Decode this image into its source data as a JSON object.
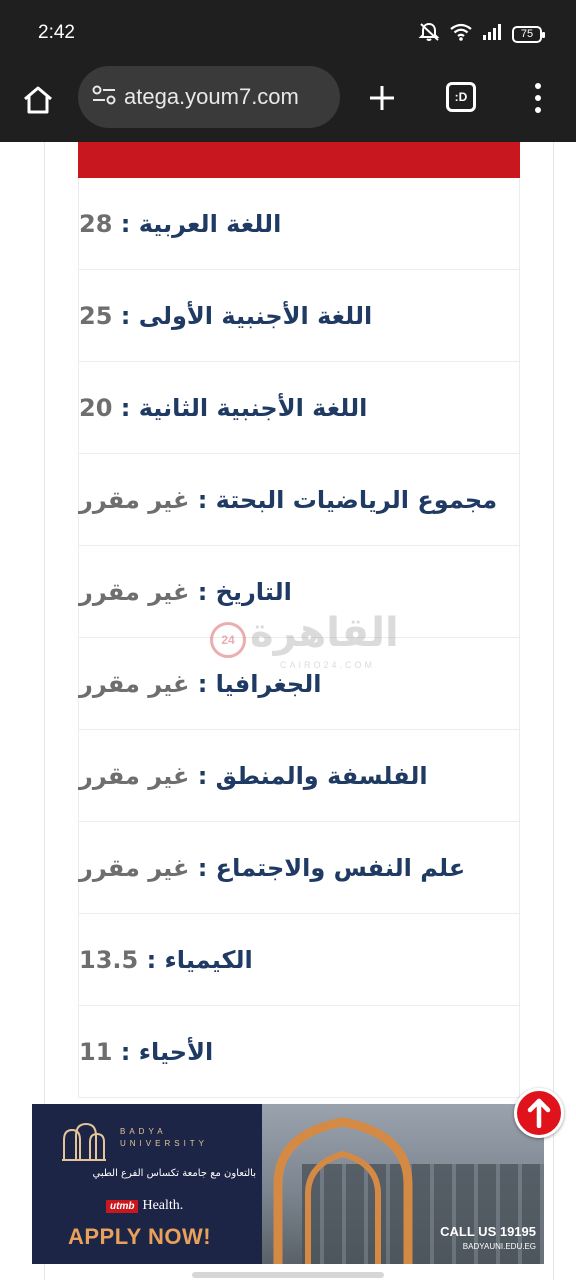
{
  "status_bar": {
    "time": "2:42",
    "battery": "75"
  },
  "browser": {
    "url": "atega.youm7.com",
    "tabs_label": ":D"
  },
  "results": [
    {
      "subject": "اللغة العربية",
      "value": "28"
    },
    {
      "subject": "اللغة الأجنبية الأولى",
      "value": "25"
    },
    {
      "subject": "اللغة الأجنبية الثانية",
      "value": "20"
    },
    {
      "subject": "مجموع الرياضيات البحتة",
      "value": "غير مقرر"
    },
    {
      "subject": "التاريخ",
      "value": "غير مقرر"
    },
    {
      "subject": "الجغرافيا",
      "value": "غير مقرر"
    },
    {
      "subject": "الفلسفة والمنطق",
      "value": "غير مقرر"
    },
    {
      "subject": "علم النفس والاجتماع",
      "value": "غير مقرر"
    },
    {
      "subject": "الكيمياء",
      "value": "13.5"
    },
    {
      "subject": "الأحياء",
      "value": "11"
    }
  ],
  "separator": " : ",
  "watermark": {
    "word": "القاهرة",
    "badge": "24",
    "sub": "CAIRO24.COM"
  },
  "ad": {
    "brand_line1": "BADYA",
    "brand_line2": "UNIVERSITY",
    "arabic_line": "بالتعاون مع جامعة تكساس الفرع الطبي",
    "partner_tag": "utmb",
    "partner_name": "Health.",
    "cta": "APPLY NOW!",
    "call": "CALL US 19195",
    "web": "BADYAUNI.EDU.EG"
  },
  "colors": {
    "header_red": "#c8171e",
    "subject_blue": "#1f3a63",
    "value_gray": "#6e6e6e",
    "ad_navy": "#1c2546",
    "cta_orange": "#e8a05a"
  }
}
